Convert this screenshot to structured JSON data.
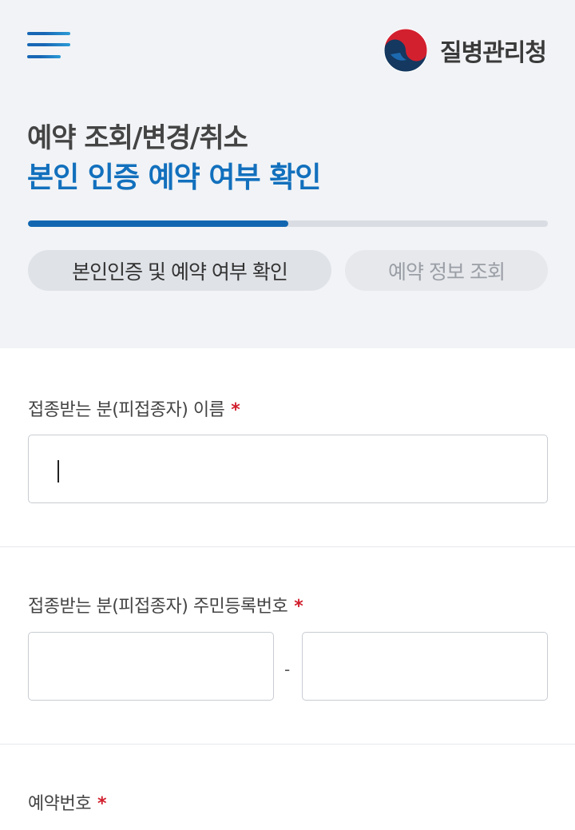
{
  "header": {
    "menu_icon": "hamburger-icon",
    "logo_icon": "kdca-emblem-icon",
    "agency_name": "질병관리청"
  },
  "page": {
    "title": "예약 조회/변경/취소",
    "subtitle": "본인 인증 예약 여부 확인"
  },
  "progress": {
    "value": 0.5
  },
  "steps": [
    {
      "label": "본인인증 및 예약 여부 확인",
      "active": true
    },
    {
      "label": "예약 정보 조회",
      "active": false
    }
  ],
  "form": {
    "name_label": "접종받는 분(피접종자) 이름",
    "name_value": "",
    "rrn_label": "접종받는 분(피접종자) 주민등록번호",
    "rrn_front_value": "",
    "rrn_back_value": "",
    "rrn_separator": "-",
    "reservation_label": "예약번호",
    "required_mark": "*"
  },
  "colors": {
    "accent": "#1270bd",
    "progress": "#1266b0",
    "required": "#d11e2c",
    "header_bg": "#f1f3f6"
  }
}
